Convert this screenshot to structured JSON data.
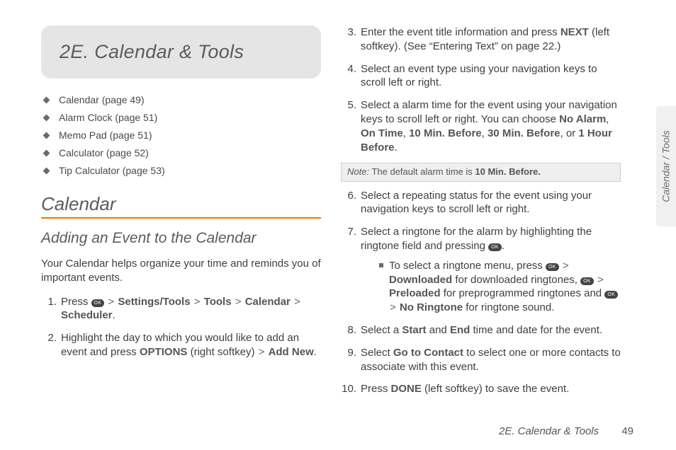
{
  "banner": {
    "title": "2E.  Calendar & Tools"
  },
  "toc": [
    "Calendar (page 49)",
    "Alarm Clock (page 51)",
    "Memo Pad (page 51)",
    "Calculator (page 52)",
    "Tip Calculator (page 53)"
  ],
  "section_title": "Calendar",
  "subsection_title": "Adding an Event to the Calendar",
  "intro": "Your Calendar helps organize your time and reminds you of important events.",
  "ok_label": "OK",
  "gt": ">",
  "steps": {
    "s1": {
      "pre": "Press ",
      "b1": "Settings/Tools",
      "b2": "Tools",
      "b3": "Calendar",
      "b4": "Scheduler",
      "dot": "."
    },
    "s2": {
      "pre": "Highlight the day to which you would like to add an event and press ",
      "b1": "OPTIONS",
      "mid": " (right softkey) ",
      "b2": "Add New",
      "dot": "."
    },
    "s3": {
      "pre": "Enter the event title information and press ",
      "b1": "NEXT",
      "post": " (left softkey). (See “Entering Text” on page 22.)"
    },
    "s4": "Select an event type using your navigation keys to scroll left or right.",
    "s5": {
      "pre": "Select a alarm time for the event using your navigation keys to scroll left or right. You can choose ",
      "b1": "No Alarm",
      "c": ", ",
      "b2": "On Time",
      "b3": "10 Min. Before",
      "b4": "30 Min. Before",
      "or": ", or ",
      "b5": "1 Hour Before",
      "dot": "."
    },
    "s6": "Select a repeating status for the event using your navigation keys to scroll left or right.",
    "s7": {
      "pre": "Select a ringtone for the alarm by highlighting the ringtone field and pressing ",
      "dot": "."
    },
    "s7sub": {
      "pre": "To select a ringtone menu, press ",
      "b1": "Downloaded",
      "mid1": " for downloaded ringtones, ",
      "b2": "Preloaded",
      "mid2": " for preprogrammed ringtones and ",
      "b3": "No Ringtone",
      "post": " for ringtone sound."
    },
    "s8": {
      "pre": "Select a ",
      "b1": "Start",
      "and": " and ",
      "b2": "End",
      "post": " time and date for the event."
    },
    "s9": {
      "pre": "Select ",
      "b1": "Go to Contact",
      "post": " to select one or more contacts to associate with this event."
    },
    "s10": {
      "pre": "Press ",
      "b1": "DONE",
      "post": " (left softkey) to save the event."
    }
  },
  "note": {
    "label": "Note:",
    "text_pre": "  The default alarm time is ",
    "bold": "10 Min. Before."
  },
  "side_tab": "Calendar / Tools",
  "footer": {
    "title": "2E. Calendar & Tools",
    "page": "49"
  }
}
